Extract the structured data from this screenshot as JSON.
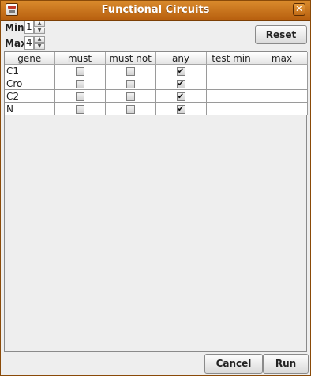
{
  "window": {
    "title": "Functional Circuits"
  },
  "controls": {
    "min_label": "Min",
    "min_value": "1",
    "max_label": "Max",
    "max_value": "4",
    "reset_label": "Reset"
  },
  "table": {
    "columns": [
      "gene",
      "must",
      "must not",
      "any",
      "test min",
      "max"
    ],
    "rows": [
      {
        "gene": "C1",
        "must": false,
        "must_not": false,
        "any": true,
        "test_min": "",
        "max": ""
      },
      {
        "gene": "Cro",
        "must": false,
        "must_not": false,
        "any": true,
        "test_min": "",
        "max": ""
      },
      {
        "gene": "C2",
        "must": false,
        "must_not": false,
        "any": true,
        "test_min": "",
        "max": ""
      },
      {
        "gene": "N",
        "must": false,
        "must_not": false,
        "any": true,
        "test_min": "",
        "max": ""
      }
    ]
  },
  "buttons": {
    "cancel": "Cancel",
    "run": "Run"
  },
  "icons": {
    "app": "app-icon",
    "close": "close-icon",
    "spin_up": "spinner-up-icon",
    "spin_down": "spinner-down-icon"
  }
}
